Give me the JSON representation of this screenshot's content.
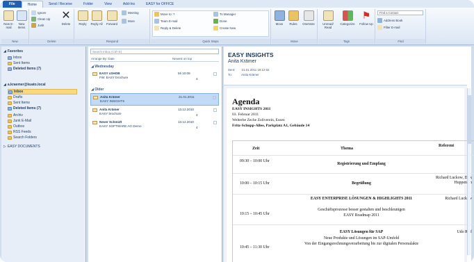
{
  "tabs": [
    "File",
    "Home",
    "Send / Receive",
    "Folder",
    "View",
    "Add-Ins",
    "EASY for OFFICE"
  ],
  "ribbon": {
    "new_email": "New E-mail",
    "new_items": "New Items",
    "ignore": "Ignore",
    "clean_up": "Clean Up",
    "junk": "Junk",
    "delete": "Delete",
    "reply": "Reply",
    "reply_all": "Reply All",
    "forward": "Forward",
    "meeting": "Meeting",
    "more": "More",
    "move_to": "Move to: ?",
    "team_email": "Team E-mail",
    "reply_delete": "Reply & Delete",
    "to_manager": "To Manager",
    "done": "Done",
    "create_new": "Create New",
    "move": "Move",
    "rules": "Rules",
    "onenote": "OneNote",
    "unread_read": "Unread/ Read",
    "categorize": "Categorize",
    "follow_up": "Follow Up",
    "find_contact": "Find a Contact",
    "address_book": "Address Book",
    "filter_email": "Filter E-mail",
    "groups": [
      "New",
      "Delete",
      "Respond",
      "Quick Steps",
      "Move",
      "Tags",
      "Find"
    ]
  },
  "nav": {
    "favorites": "Favorites",
    "inbox": "Inbox",
    "sent_items": "Sent Items",
    "deleted_items": "Deleted Items (7)",
    "account": "a.kraemer@kuato.local",
    "folders": [
      "Inbox",
      "Drafts",
      "Sent Items",
      "Deleted Items (7)",
      "Archiv",
      "Junk E-Mail",
      "Outbox",
      "RSS Feeds",
      "Search Folders"
    ],
    "easy_documents": "EASY DOCUMENTS"
  },
  "list": {
    "search_placeholder": "Search Inbox (Ctrl+E)",
    "arrange_by": "Arrange By: Date",
    "sort_order": "Newest on top",
    "group_wednesday": "Wednesday",
    "group_older": "Older",
    "messages": [
      {
        "from": "EASY xSHOB",
        "subject": "FW: EASY brochure",
        "date": "Mi 10:08",
        "count": "4"
      },
      {
        "from": "Anita Krämer",
        "subject": "EASY INSIGHTS",
        "date": "21.01.2011",
        "count": ""
      },
      {
        "from": "Anita Krämer",
        "subject": "EASY brochure",
        "date": "13.12.2010",
        "count": "4"
      },
      {
        "from": "Never Schmidt",
        "subject": "EASY SOFTWARE AG Demo",
        "date": "13.12.2010",
        "count": "4"
      }
    ]
  },
  "reading": {
    "title": "EASY INSIGHTS",
    "sender": "Anita Krämer",
    "sent_label": "Sent:",
    "sent_value": "21.01.2011 19:12:02",
    "to_label": "To:",
    "to_value": "Anita Krämer",
    "agenda_title": "Agenda",
    "agenda_lines": [
      "EASY INSIGHTS 2011",
      "03. Februar 2011",
      "Welterbe Zeche Zollverein, Essen",
      "Fritz-Schupp-Allee, Parkplatz A1, Gebäude 14"
    ],
    "table_headers": [
      "Zeit",
      "Thema",
      "Referent"
    ],
    "table_rows": [
      {
        "time": "09:30 – 10:00 Uhr",
        "topic_bold": "Registrierung und Empfang",
        "topic": "",
        "topic2": "",
        "speaker": ""
      },
      {
        "time": "10:00 – 10:15 Uhr",
        "topic_bold": "Begrüßung",
        "topic": "",
        "topic2": "",
        "speaker": "Richard Luckow, Dirk Huppenich"
      },
      {
        "time": "10:15 – 10:45 Uhr",
        "topic_bold": "EASY ENTERPRISE LÖSUNGEN & HIGHLIGHTS 2011",
        "topic": "Geschäftsprozesse besser gestalten und beschleunigen",
        "topic2": "EASY Roadmap 2011",
        "speaker": "Richard Luckow"
      },
      {
        "time": "10:45 – 11:30 Uhr",
        "topic_bold": "EASY Lösungen für SAP",
        "topic": "Neue Produkte und Lösungen im SAP-Umfeld",
        "topic2": "Von der Eingangsrechnungsverarbeitung bis zur digitalen Personalakte",
        "speaker": "Udo Ralf"
      }
    ]
  }
}
